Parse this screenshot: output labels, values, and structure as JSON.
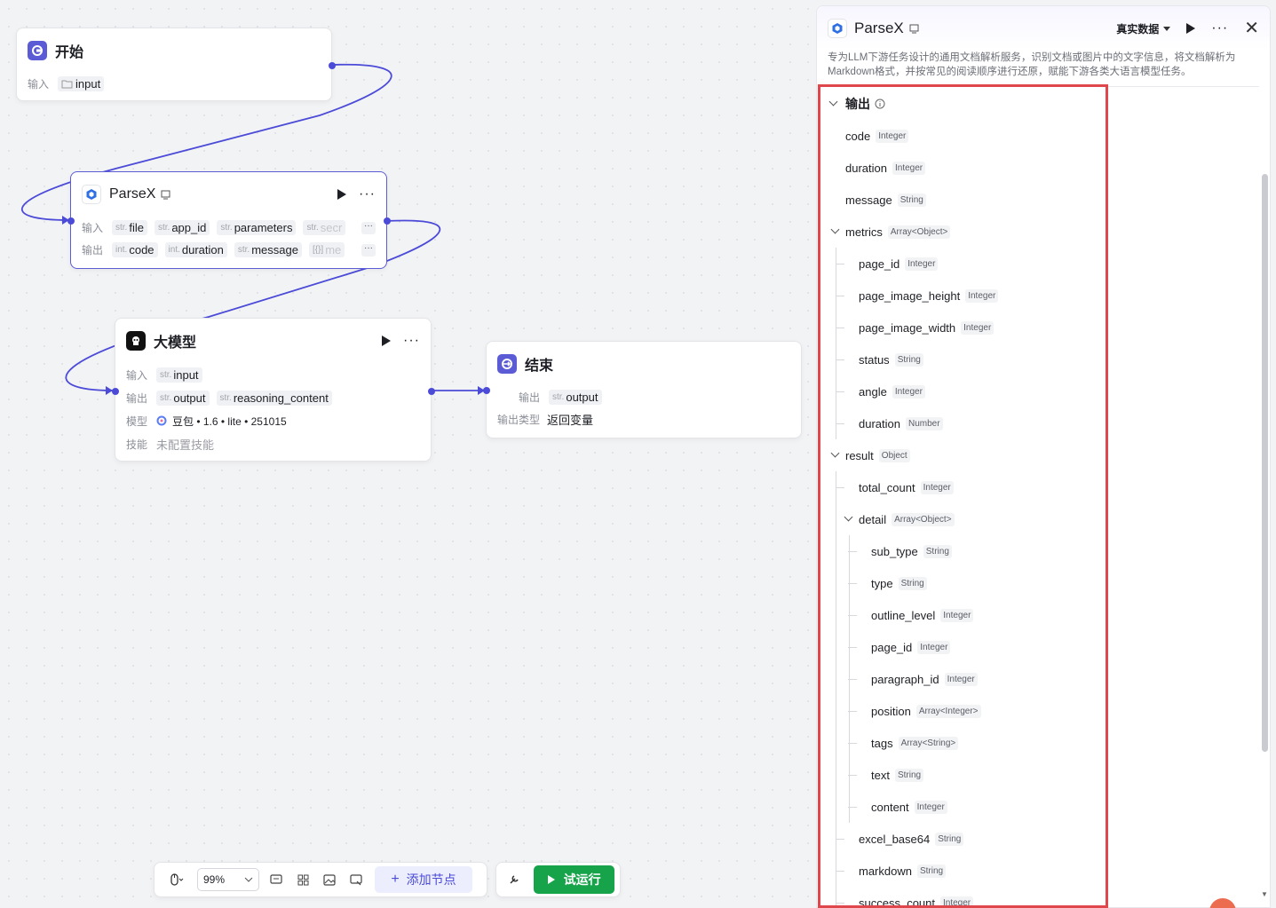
{
  "canvas": {
    "nodes": {
      "start": {
        "title": "开始",
        "input_label": "输入",
        "input_var": "input"
      },
      "parsex": {
        "title": "ParseX",
        "input_label": "输入",
        "output_label": "输出",
        "inputs": [
          {
            "type": "str.",
            "name": "file"
          },
          {
            "type": "str.",
            "name": "app_id"
          },
          {
            "type": "str.",
            "name": "parameters"
          },
          {
            "type": "str.",
            "name": "secr"
          }
        ],
        "outputs": [
          {
            "type": "int.",
            "name": "code"
          },
          {
            "type": "int.",
            "name": "duration"
          },
          {
            "type": "str.",
            "name": "message"
          },
          {
            "type": "[{}]",
            "name": "me"
          }
        ],
        "more": "···"
      },
      "llm": {
        "title": "大模型",
        "input_label": "输入",
        "output_label": "输出",
        "model_label": "模型",
        "skills_label": "技能",
        "inputs": [
          {
            "type": "str.",
            "name": "input"
          }
        ],
        "outputs": [
          {
            "type": "str.",
            "name": "output"
          },
          {
            "type": "str.",
            "name": "reasoning_content"
          }
        ],
        "model_value": "豆包 • 1.6 • lite • 251015",
        "skills_value": "未配置技能"
      },
      "end": {
        "title": "结束",
        "output_label": "输出",
        "output_type_label": "输出类型",
        "outputs": [
          {
            "type": "str.",
            "name": "output"
          }
        ],
        "output_type_value": "返回变量"
      }
    },
    "toolbar": {
      "zoom": "99%",
      "add_node": "添加节点",
      "run": "试运行"
    }
  },
  "panel": {
    "title": "ParseX",
    "real_data": "真实数据",
    "description": "专为LLM下游任务设计的通用文档解析服务，识别文档或图片中的文字信息，将文档解析为Markdown格式，并按常见的阅读顺序进行还原，赋能下游各类大语言模型任务。",
    "output_section": "输出",
    "fields": [
      {
        "name": "code",
        "type": "Integer",
        "level": 0
      },
      {
        "name": "duration",
        "type": "Integer",
        "level": 0
      },
      {
        "name": "message",
        "type": "String",
        "level": 0
      },
      {
        "name": "metrics",
        "type": "Array<Object>",
        "level": 0,
        "expanded": true
      },
      {
        "name": "page_id",
        "type": "Integer",
        "level": 1
      },
      {
        "name": "page_image_height",
        "type": "Integer",
        "level": 1
      },
      {
        "name": "page_image_width",
        "type": "Integer",
        "level": 1
      },
      {
        "name": "status",
        "type": "String",
        "level": 1
      },
      {
        "name": "angle",
        "type": "Integer",
        "level": 1
      },
      {
        "name": "duration",
        "type": "Number",
        "level": 1
      },
      {
        "name": "result",
        "type": "Object",
        "level": 0,
        "expanded": true
      },
      {
        "name": "total_count",
        "type": "Integer",
        "level": 1
      },
      {
        "name": "detail",
        "type": "Array<Object>",
        "level": 1,
        "expanded": true
      },
      {
        "name": "sub_type",
        "type": "String",
        "level": 2
      },
      {
        "name": "type",
        "type": "String",
        "level": 2
      },
      {
        "name": "outline_level",
        "type": "Integer",
        "level": 2
      },
      {
        "name": "page_id",
        "type": "Integer",
        "level": 2
      },
      {
        "name": "paragraph_id",
        "type": "Integer",
        "level": 2
      },
      {
        "name": "position",
        "type": "Array<Integer>",
        "level": 2
      },
      {
        "name": "tags",
        "type": "Array<String>",
        "level": 2
      },
      {
        "name": "text",
        "type": "String",
        "level": 2
      },
      {
        "name": "content",
        "type": "Integer",
        "level": 2
      },
      {
        "name": "excel_base64",
        "type": "String",
        "level": 1
      },
      {
        "name": "markdown",
        "type": "String",
        "level": 1
      },
      {
        "name": "success_count",
        "type": "Integer",
        "level": 1
      }
    ]
  },
  "colors": {
    "accent": "#4b4bd8",
    "run_green": "#16a34a",
    "highlight_red": "#e0474c"
  }
}
